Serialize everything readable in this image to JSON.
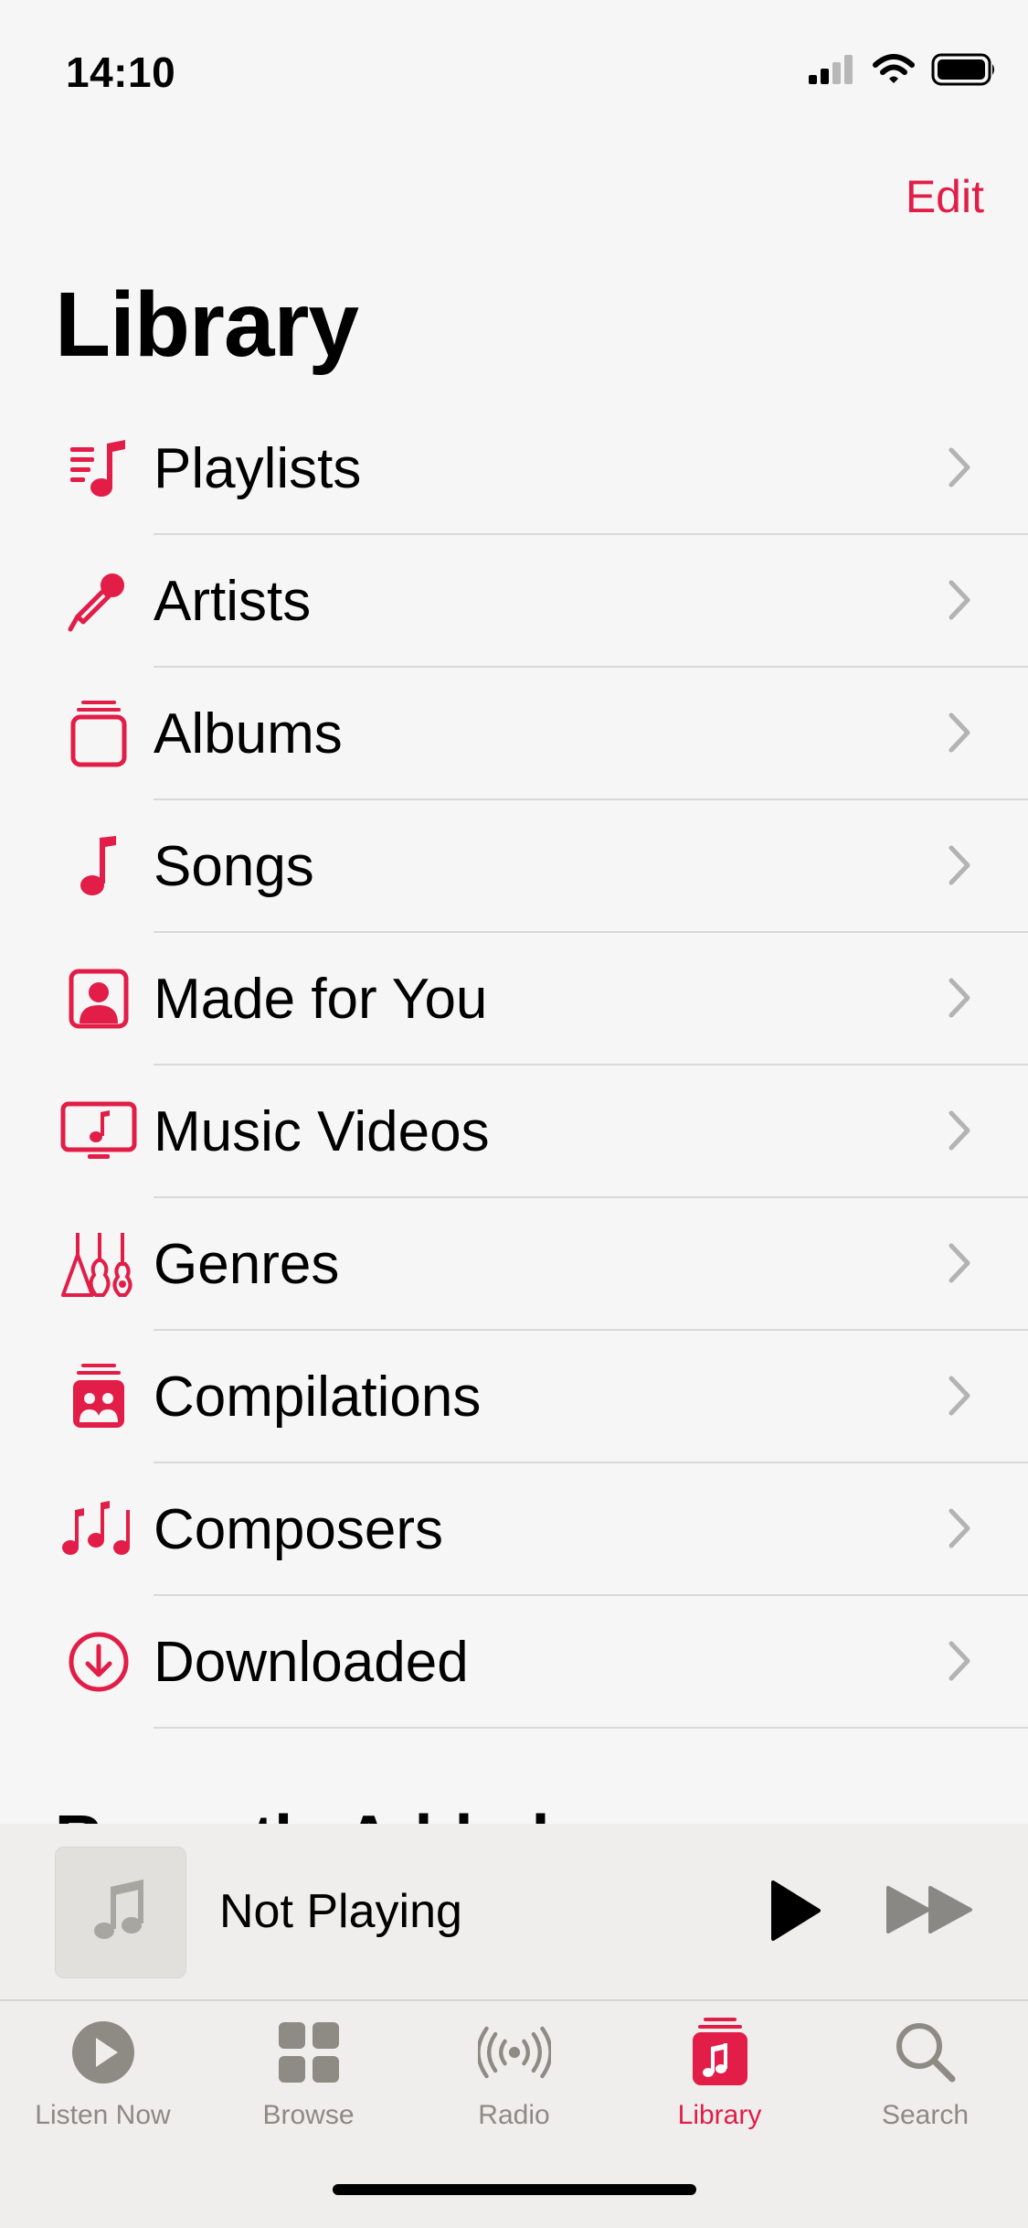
{
  "status_bar": {
    "time": "14:10"
  },
  "header": {
    "edit_label": "Edit",
    "title": "Library"
  },
  "library_items": [
    {
      "label": "Playlists",
      "icon": "playlists-icon"
    },
    {
      "label": "Artists",
      "icon": "microphone-icon"
    },
    {
      "label": "Albums",
      "icon": "album-stack-icon"
    },
    {
      "label": "Songs",
      "icon": "music-note-icon"
    },
    {
      "label": "Made for You",
      "icon": "person-square-icon"
    },
    {
      "label": "Music Videos",
      "icon": "tv-music-icon"
    },
    {
      "label": "Genres",
      "icon": "guitars-icon"
    },
    {
      "label": "Compilations",
      "icon": "compilations-icon"
    },
    {
      "label": "Composers",
      "icon": "music-notes-icon"
    },
    {
      "label": "Downloaded",
      "icon": "download-circle-icon"
    }
  ],
  "section": {
    "title": "Recently Added"
  },
  "mini_player": {
    "title": "Not Playing"
  },
  "tabs": [
    {
      "label": "Listen Now",
      "icon": "play-circle-icon",
      "active": false
    },
    {
      "label": "Browse",
      "icon": "grid-icon",
      "active": false
    },
    {
      "label": "Radio",
      "icon": "radio-waves-icon",
      "active": false
    },
    {
      "label": "Library",
      "icon": "library-icon",
      "active": true
    },
    {
      "label": "Search",
      "icon": "magnifier-icon",
      "active": false
    }
  ],
  "colors": {
    "accent": "#e11d48",
    "background": "#f6f6f6",
    "tab_inactive": "#8e8a84"
  }
}
